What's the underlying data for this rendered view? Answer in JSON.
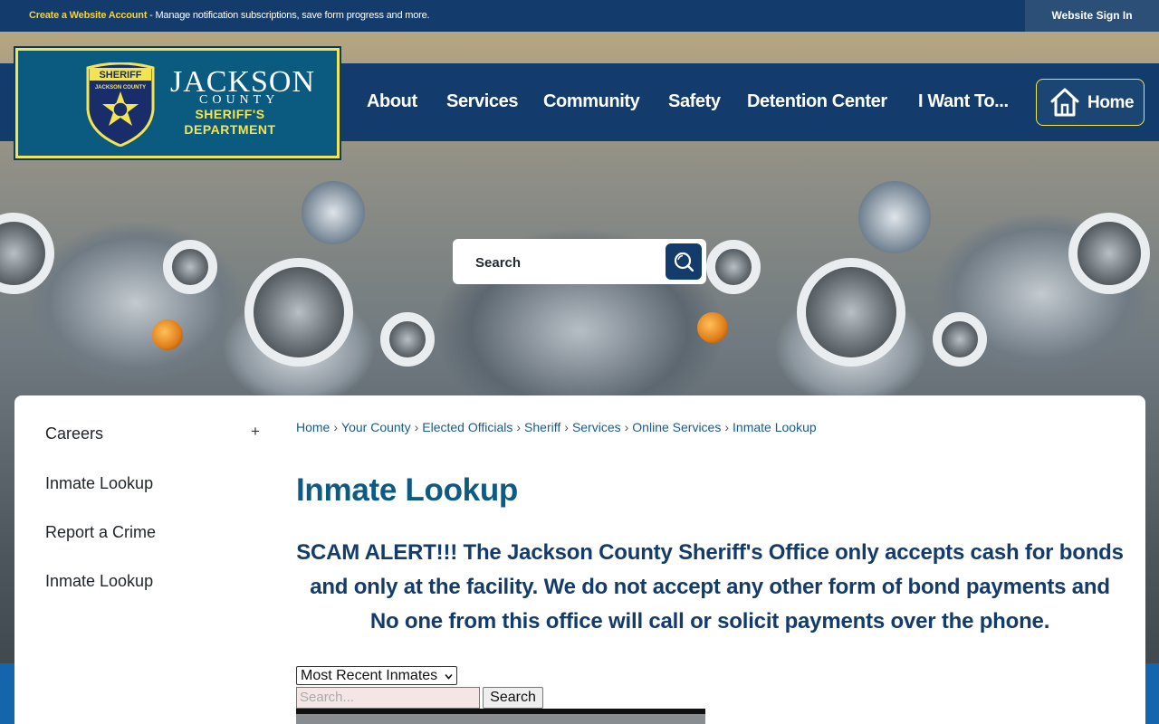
{
  "topbar": {
    "create_account": "Create a Website Account",
    "message": " - Manage notification subscriptions, save form progress and more.",
    "sign_in": "Website Sign In"
  },
  "logo": {
    "badge_top": "SHERIFF",
    "badge_ring": "JACKSON COUNTY",
    "name": "JACKSON",
    "county": "COUNTY",
    "dept_line1": "SHERIFF'S",
    "dept_line2": "DEPARTMENT"
  },
  "nav": {
    "items": [
      "About",
      "Services",
      "Community",
      "Safety",
      "Detention Center",
      "I Want To..."
    ],
    "home": "Home",
    "home_icon": "house-icon"
  },
  "search": {
    "label": "Search",
    "icon": "magnifier-icon"
  },
  "sidebar": {
    "items": [
      {
        "label": "Careers",
        "expand": "+"
      },
      {
        "label": "Inmate Lookup"
      },
      {
        "label": "Report a Crime"
      },
      {
        "label": "Inmate Lookup"
      }
    ]
  },
  "breadcrumb": [
    "Home",
    "Your County",
    "Elected Officials",
    "Sheriff",
    "Services",
    "Online Services",
    "Inmate Lookup"
  ],
  "page": {
    "title": "Inmate Lookup",
    "alert": "SCAM ALERT!!! The Jackson County Sheriff's Office only accepts cash for bonds and only at the facility. We do not accept any other form of bond payments and No one from this office will call or solicit payments over the phone."
  },
  "lookup": {
    "select_value": "Most Recent Inmates",
    "search_placeholder": "Search...",
    "search_button": "Search"
  },
  "colors": {
    "navy": "#133b6b",
    "gold": "#f3e552",
    "title_blue": "#0d5a82",
    "link_blue": "#1a5b87"
  }
}
